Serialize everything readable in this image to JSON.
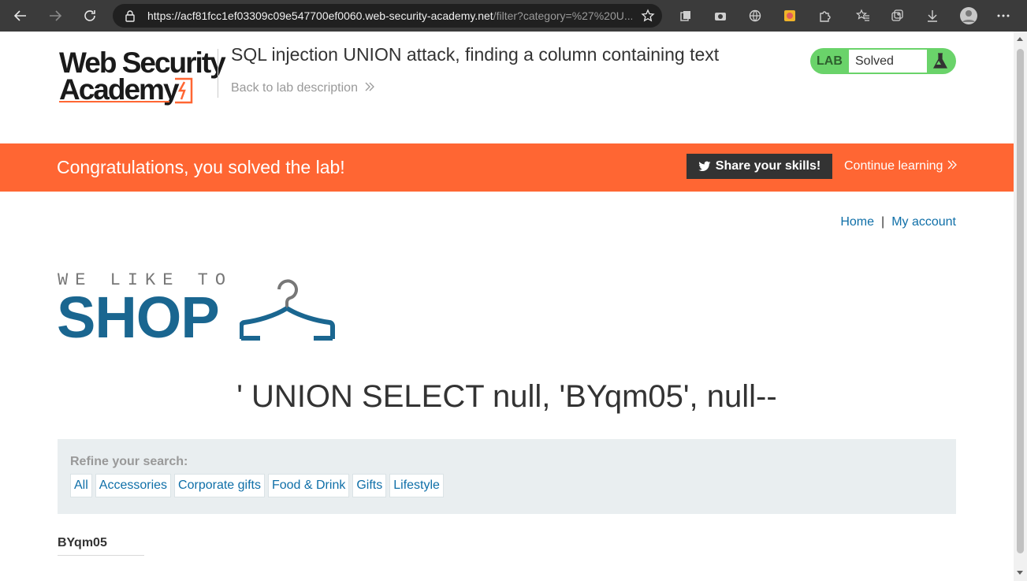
{
  "browser": {
    "url_host": "https://acf81fcc1ef03309c09e547700ef0060.web-security-academy.net",
    "url_path": "/filter?category=%27%20U..."
  },
  "header": {
    "logo_line1": "Web Security",
    "logo_line2": "Academy",
    "lab_title": "SQL injection UNION attack, finding a column containing text",
    "back_link": "Back to lab description",
    "lab_badge_label": "LAB",
    "lab_status": "Solved"
  },
  "banner": {
    "text": "Congratulations, you solved the lab!",
    "share_label": "Share your skills!",
    "continue_label": "Continue learning"
  },
  "nav": {
    "home": "Home",
    "separator": "|",
    "account": "My account"
  },
  "shop_logo": {
    "tagline": "WE LIKE TO",
    "word": "SHOP"
  },
  "main": {
    "query_title": "' UNION SELECT null, 'BYqm05', null--",
    "refine_label": "Refine your search:",
    "filters": [
      "All",
      "Accessories",
      "Corporate gifts",
      "Food & Drink",
      "Gifts",
      "Lifestyle"
    ],
    "result": "BYqm05"
  },
  "colors": {
    "banner": "#ff6633",
    "badge": "#6ad36a",
    "link": "#0f6fa8",
    "shop_blue": "#1a6690"
  }
}
